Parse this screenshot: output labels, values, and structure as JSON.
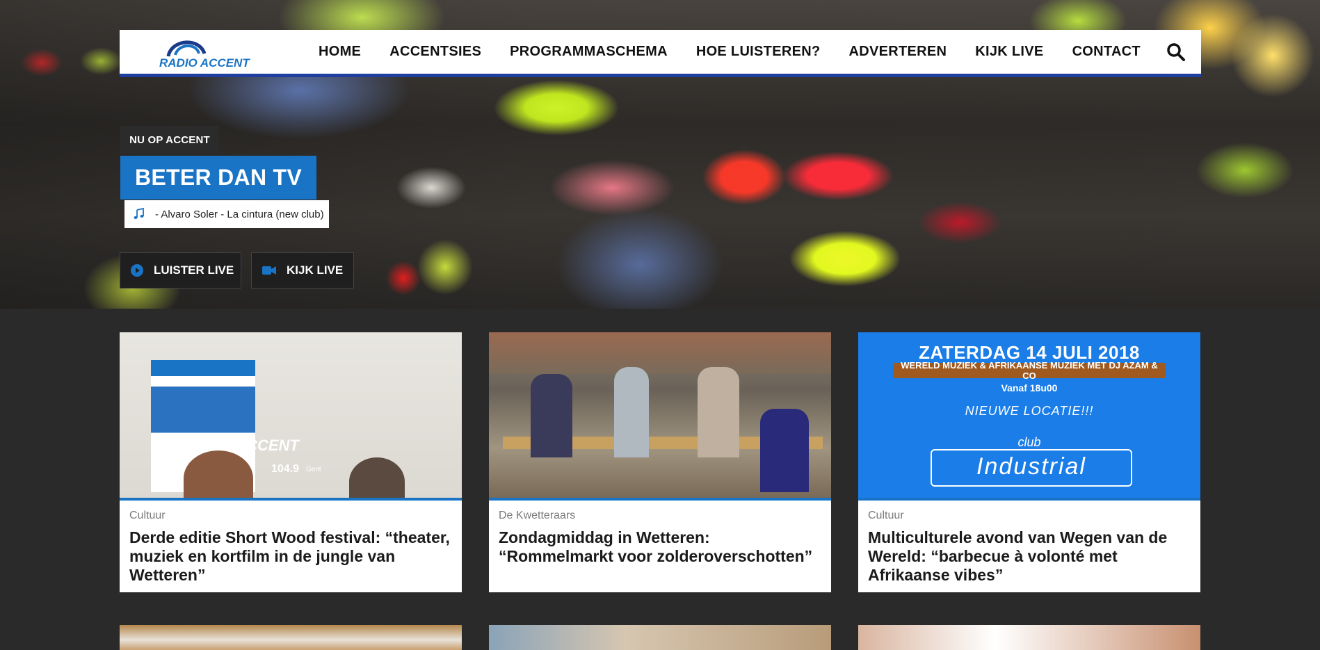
{
  "brand": {
    "logo_text": "RADIO ACCENT",
    "primary_color": "#1e3fa0",
    "accent_color": "#1a74c6"
  },
  "nav": {
    "items": [
      {
        "label": "HOME"
      },
      {
        "label": "ACCENTSIES"
      },
      {
        "label": "PROGRAMMASCHEMA"
      },
      {
        "label": "HOE LUISTEREN?"
      },
      {
        "label": "ADVERTEREN"
      },
      {
        "label": "KIJK LIVE"
      },
      {
        "label": "CONTACT"
      }
    ],
    "search_icon": "search-icon"
  },
  "hero": {
    "now_label": "NU OP ACCENT",
    "show_title": "BETER DAN TV",
    "now_playing": "- Alvaro Soler - La cintura (new club)",
    "buttons": {
      "listen": "LUISTER LIVE",
      "watch": "KIJK LIVE"
    }
  },
  "cards": [
    {
      "category": "Cultuur",
      "title": "Derde editie Short Wood festival: “theater, muziek en kortfilm in de jungle van Wetteren”",
      "image_text": {
        "brand": "RADIO ACCENT",
        "freq": "104.9",
        "city": "Gent"
      }
    },
    {
      "category": "De Kwetteraars",
      "title": "Zondagmiddag in Wetteren: “Rommelmarkt voor zolderoverschotten”"
    },
    {
      "category": "Cultuur",
      "title": "Multiculturele avond van Wegen van de Wereld: “barbecue à volonté met Afrikaanse vibes”",
      "image_text": {
        "date": "ZATERDAG 14 JULI 2018",
        "subtitle": "WERELD MUZIEK & AFRIKAANSE MUZIEK MET DJ AZAM & CO",
        "time": "Vanaf 18u00",
        "location": "NIEUWE LOCATIE!!!",
        "club_small": "club",
        "club_name": "Industrial"
      }
    }
  ]
}
